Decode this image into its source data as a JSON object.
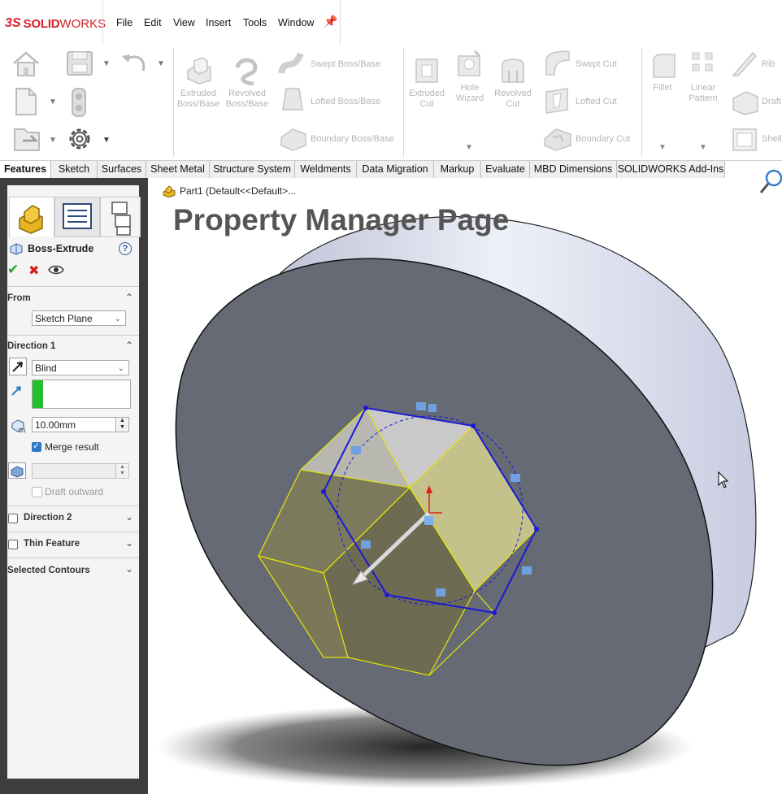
{
  "app": {
    "logo_ds": "3S",
    "logo_solid": "SOLID",
    "logo_works": "WORKS"
  },
  "menu": {
    "items": [
      "File",
      "Edit",
      "View",
      "Insert",
      "Tools",
      "Window"
    ]
  },
  "command_manager": {
    "extruded_boss": "Extruded\nBoss/Base",
    "revolved_boss": "Revolved\nBoss/Base",
    "swept_boss": "Swept Boss/Base",
    "lofted_boss": "Lofted Boss/Base",
    "boundary_boss": "Boundary Boss/Base",
    "extruded_cut": "Extruded\nCut",
    "hole_wizard": "Hole\nWizard",
    "revolved_cut": "Revolved\nCut",
    "swept_cut": "Swept Cut",
    "lofted_cut": "Lofted Cut",
    "boundary_cut": "Boundary Cut",
    "fillet": "Fillet",
    "linear_pattern": "Linear\nPattern",
    "rib": "Rib",
    "draft": "Draft",
    "shell": "Shell"
  },
  "tabs": [
    "Features",
    "Sketch",
    "Surfaces",
    "Sheet Metal",
    "Structure System",
    "Weldments",
    "Data Migration",
    "Markup",
    "Evaluate",
    "MBD Dimensions",
    "SOLIDWORKS Add-Ins"
  ],
  "active_tab": "Features",
  "tree": {
    "part_label": "Part1  (Default<<Default>..."
  },
  "overlay_title": "Property Manager Page",
  "property_manager": {
    "feature_name": "Boss-Extrude",
    "help": "?",
    "from_label": "From",
    "from_value": "Sketch Plane",
    "direction1_label": "Direction 1",
    "end_condition": "Blind",
    "depth": "10.00mm",
    "merge_result": "Merge result",
    "merge_checked": true,
    "draft_outward": "Draft outward",
    "direction2_label": "Direction 2",
    "thin_feature_label": "Thin Feature",
    "selected_contours_label": "Selected Contours"
  },
  "colors": {
    "accent_red": "#d71f26",
    "sketch_blue": "#1a1ad6",
    "preview_yellow": "#e8e800",
    "face_gray": "#666a75",
    "pm_frame": "#3e3e3e"
  }
}
